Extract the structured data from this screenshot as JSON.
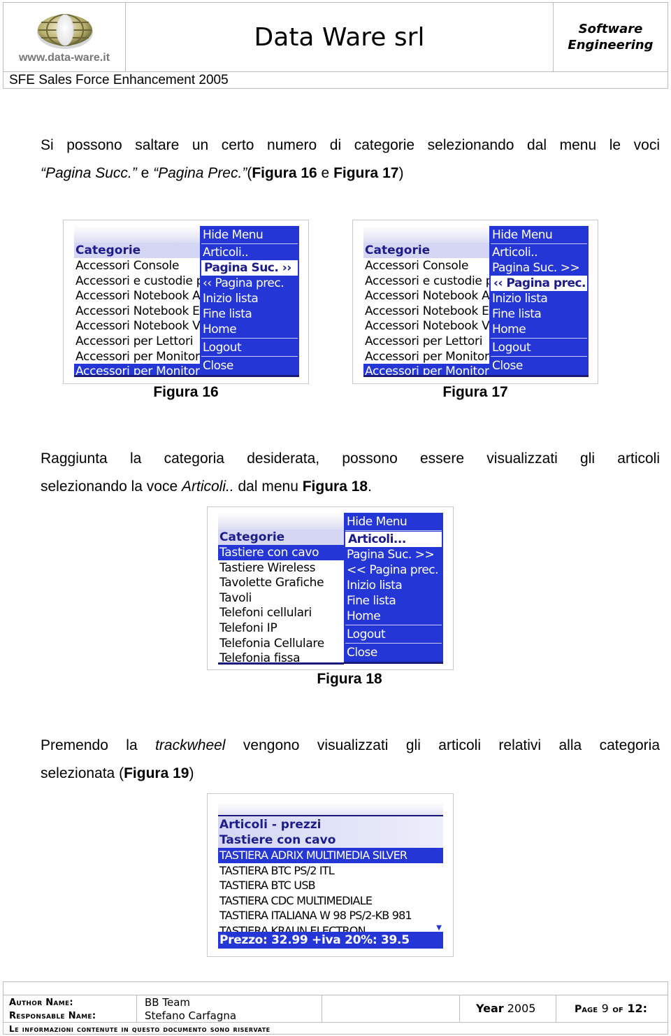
{
  "header": {
    "logo_url_text": "www.data-ware.it",
    "company": "Data Ware srl",
    "tagline_line1": "Software",
    "tagline_line2": "Engineering",
    "subtitle": "SFE Sales Force Enhancement  2005"
  },
  "paragraphs": {
    "p1_line1": "Si possono saltare un certo numero di categorie selezionando dal menu le voci",
    "p1_q1": "“Pagina Succ.”",
    "p1_and": " e ",
    "p1_q2": "“Pagina Prec.”",
    "p1_open": "(",
    "p1_fig16": "Figura 16",
    "p1_e": " e ",
    "p1_fig17": "Figura 17",
    "p1_close": ")",
    "p2_line1": "Raggiunta la categoria desiderata, possono essere visualizzati gli articoli",
    "p2_pre": "selezionando la voce ",
    "p2_italic": "Articoli..",
    "p2_mid": " dal menu ",
    "p2_fig": "Figura 18",
    "p2_end": ".",
    "p3_pre": "Premendo la ",
    "p3_italic": "trackwheel",
    "p3_post": " vengono visualizzati gli articoli relativi alla categoria",
    "p3_line2_pre": "selezionata (",
    "p3_fig": "Figura 19",
    "p3_line2_post": ")"
  },
  "figures": {
    "fig16": {
      "caption": "Figura 16",
      "list_title": "Categorie",
      "rows": [
        "Accessori Console",
        "Accessori e custodie p",
        "Accessori Notebook A",
        "Accessori Notebook E",
        "Accessori Notebook V",
        "Accessori per Lettori",
        "Accessori per Monitor",
        "Accessori per Monitor"
      ],
      "selected_row": 7,
      "menu": [
        "Hide Menu",
        "Articoli..",
        "Pagina Suc. ››",
        "‹‹ Pagina prec.",
        "Inizio lista",
        "Fine lista",
        "Home",
        "Logout",
        "Close"
      ],
      "selected_menu": 2
    },
    "fig17": {
      "caption": "Figura 17",
      "list_title": "Categorie",
      "rows": [
        "Accessori Console",
        "Accessori e custodie p",
        "Accessori Notebook A",
        "Accessori Notebook E",
        "Accessori Notebook V",
        "Accessori per Lettori",
        "Accessori per Monitor",
        "Accessori per Monitor"
      ],
      "selected_row": 7,
      "menu": [
        "Hide Menu",
        "Articoli..",
        "Pagina Suc. >>",
        "‹‹ Pagina prec.",
        "Inizio lista",
        "Fine lista",
        "Home",
        "Logout",
        "Close"
      ],
      "selected_menu": 3
    },
    "fig18": {
      "caption": "Figura 18",
      "list_title": "Categorie",
      "rows": [
        "Tastiere con cavo",
        "Tastiere Wireless",
        "Tavolette Grafiche",
        "Tavoli",
        "Telefoni cellulari",
        "Telefoni IP",
        "Telefonia Cellulare",
        "Telefonia fissa"
      ],
      "selected_row": 0,
      "menu": [
        "Hide Menu",
        "Articoli...",
        "Pagina Suc. >>",
        "<< Pagina prec.",
        "Inizio lista",
        "Fine lista",
        "Home",
        "Logout",
        "Close"
      ],
      "selected_menu": 1
    },
    "fig19": {
      "title1": "Articoli - prezzi",
      "title2": "Tastiere con cavo",
      "rows": [
        "TASTIERA ADRIX MULTIMEDIA SILVER",
        "TASTIERA BTC PS/2 ITL",
        "TASTIERA BTC USB",
        "TASTIERA CDC MULTIMEDIALE",
        "TASTIERA ITALIANA W 98 PS/2-KB 981",
        "TASTIERA KRAUN ELECTRON"
      ],
      "selected_row": 0,
      "price_bar": "Prezzo: 32.99 +iva 20%: 39.5",
      "scroll_indicator": "▼"
    }
  },
  "footer": {
    "author_label": "Author Name:",
    "author_value": "BB Team",
    "responsable_label": "Responsable Name:",
    "responsable_value": "Stefano Carfagna",
    "year_label": "Year",
    "year_value": "2005",
    "page_label": "Page",
    "page_num": "9",
    "page_of": "of",
    "page_total": "12:",
    "notice": "Le informazioni contenute in questo documento sono riservate"
  },
  "colors": {
    "menu_blue": "#2436d6",
    "title_text": "#1c1c8c",
    "border_gray": "#bdbdbd"
  }
}
